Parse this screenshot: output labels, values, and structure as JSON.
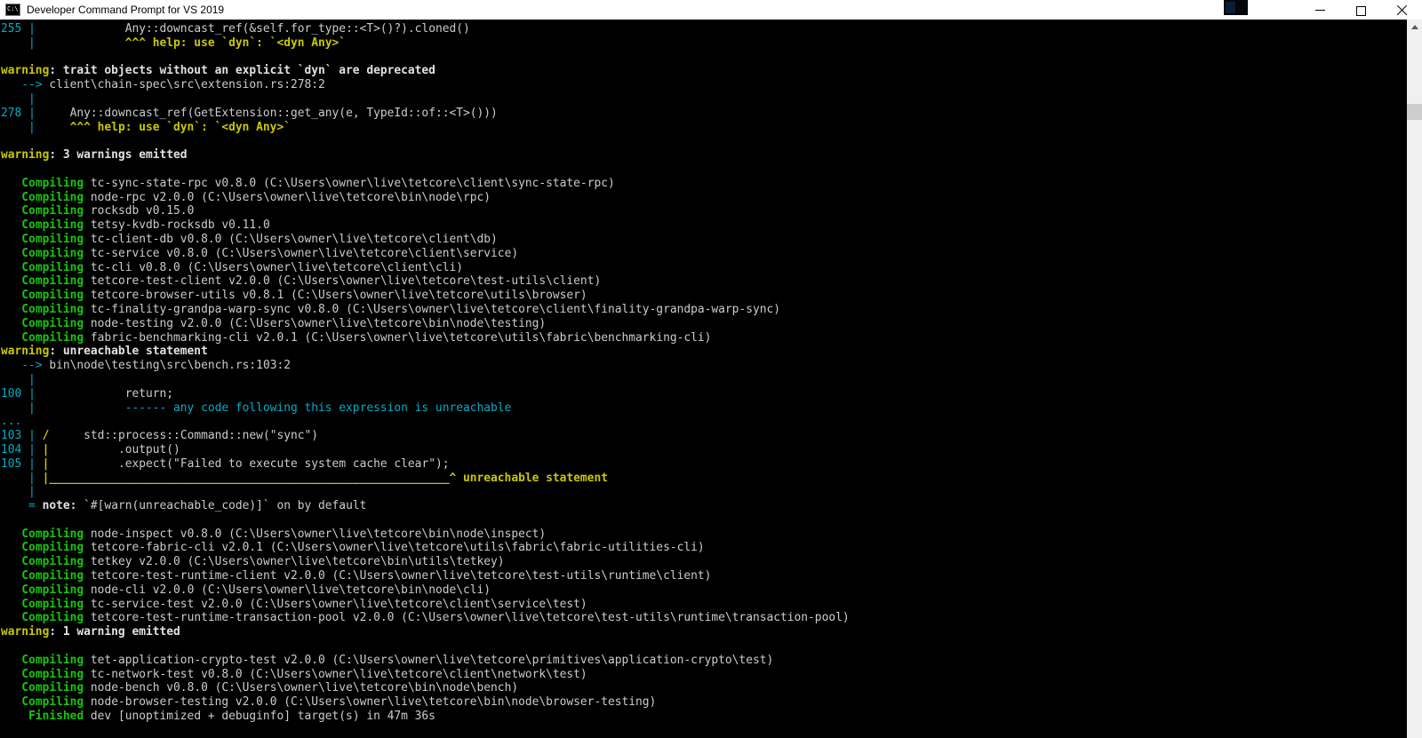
{
  "window": {
    "title": "Developer Command Prompt for VS 2019",
    "controls": {
      "minimize": "minimize",
      "restore": "restore",
      "close": "close"
    }
  },
  "terminal": {
    "colors": {
      "background": "#000000",
      "fg": "#cccccc",
      "wh": "#e2e2e2",
      "gr": "#16c60c",
      "ye": "#c9c800",
      "cy": "#00aec8"
    },
    "lines": [
      [
        [
          "cy",
          "255"
        ],
        [
          "fg",
          " "
        ],
        [
          "cy",
          "|"
        ],
        [
          "fg",
          "             Any::downcast_ref(&self.for_type::<T>()?).cloned()"
        ]
      ],
      [
        [
          "cy",
          "    |"
        ],
        [
          "ye",
          "             ^^^ help: use `dyn`: `<dyn Any>`"
        ]
      ],
      [],
      [
        [
          "ye",
          "warning"
        ],
        [
          "wh",
          ": trait objects without an explicit `dyn` are deprecated"
        ]
      ],
      [
        [
          "fg",
          "   "
        ],
        [
          "cy",
          "-->"
        ],
        [
          "fg",
          " client\\chain-spec\\src\\extension.rs:278:2"
        ]
      ],
      [
        [
          "cy",
          "    |"
        ]
      ],
      [
        [
          "cy",
          "278"
        ],
        [
          "fg",
          " "
        ],
        [
          "cy",
          "|"
        ],
        [
          "fg",
          "     Any::downcast_ref(GetExtension::get_any(e, TypeId::of::<T>()))"
        ]
      ],
      [
        [
          "cy",
          "    |"
        ],
        [
          "ye",
          "     ^^^ help: use `dyn`: `<dyn Any>`"
        ]
      ],
      [],
      [
        [
          "ye",
          "warning"
        ],
        [
          "wh",
          ": 3 warnings emitted"
        ]
      ],
      [],
      [
        [
          "fg",
          "   "
        ],
        [
          "gr",
          "Compiling"
        ],
        [
          "fg",
          " tc-sync-state-rpc v0.8.0 (C:\\Users\\owner\\live\\tetcore\\client\\sync-state-rpc)"
        ]
      ],
      [
        [
          "fg",
          "   "
        ],
        [
          "gr",
          "Compiling"
        ],
        [
          "fg",
          " node-rpc v2.0.0 (C:\\Users\\owner\\live\\tetcore\\bin\\node\\rpc)"
        ]
      ],
      [
        [
          "fg",
          "   "
        ],
        [
          "gr",
          "Compiling"
        ],
        [
          "fg",
          " rocksdb v0.15.0"
        ]
      ],
      [
        [
          "fg",
          "   "
        ],
        [
          "gr",
          "Compiling"
        ],
        [
          "fg",
          " tetsy-kvdb-rocksdb v0.11.0"
        ]
      ],
      [
        [
          "fg",
          "   "
        ],
        [
          "gr",
          "Compiling"
        ],
        [
          "fg",
          " tc-client-db v0.8.0 (C:\\Users\\owner\\live\\tetcore\\client\\db)"
        ]
      ],
      [
        [
          "fg",
          "   "
        ],
        [
          "gr",
          "Compiling"
        ],
        [
          "fg",
          " tc-service v0.8.0 (C:\\Users\\owner\\live\\tetcore\\client\\service)"
        ]
      ],
      [
        [
          "fg",
          "   "
        ],
        [
          "gr",
          "Compiling"
        ],
        [
          "fg",
          " tc-cli v0.8.0 (C:\\Users\\owner\\live\\tetcore\\client\\cli)"
        ]
      ],
      [
        [
          "fg",
          "   "
        ],
        [
          "gr",
          "Compiling"
        ],
        [
          "fg",
          " tetcore-test-client v2.0.0 (C:\\Users\\owner\\live\\tetcore\\test-utils\\client)"
        ]
      ],
      [
        [
          "fg",
          "   "
        ],
        [
          "gr",
          "Compiling"
        ],
        [
          "fg",
          " tetcore-browser-utils v0.8.1 (C:\\Users\\owner\\live\\tetcore\\utils\\browser)"
        ]
      ],
      [
        [
          "fg",
          "   "
        ],
        [
          "gr",
          "Compiling"
        ],
        [
          "fg",
          " tc-finality-grandpa-warp-sync v0.8.0 (C:\\Users\\owner\\live\\tetcore\\client\\finality-grandpa-warp-sync)"
        ]
      ],
      [
        [
          "fg",
          "   "
        ],
        [
          "gr",
          "Compiling"
        ],
        [
          "fg",
          " node-testing v2.0.0 (C:\\Users\\owner\\live\\tetcore\\bin\\node\\testing)"
        ]
      ],
      [
        [
          "fg",
          "   "
        ],
        [
          "gr",
          "Compiling"
        ],
        [
          "fg",
          " fabric-benchmarking-cli v2.0.1 (C:\\Users\\owner\\live\\tetcore\\utils\\fabric\\benchmarking-cli)"
        ]
      ],
      [
        [
          "ye",
          "warning"
        ],
        [
          "wh",
          ": unreachable statement"
        ]
      ],
      [
        [
          "fg",
          "   "
        ],
        [
          "cy",
          "-->"
        ],
        [
          "fg",
          " bin\\node\\testing\\src\\bench.rs:103:2"
        ]
      ],
      [
        [
          "cy",
          "    |"
        ]
      ],
      [
        [
          "cy",
          "100"
        ],
        [
          "fg",
          " "
        ],
        [
          "cy",
          "|"
        ],
        [
          "fg",
          "             return;"
        ]
      ],
      [
        [
          "cy",
          "    |             ------ any code following this expression is unreachable"
        ]
      ],
      [
        [
          "cy",
          "..."
        ]
      ],
      [
        [
          "cy",
          "103"
        ],
        [
          "fg",
          " "
        ],
        [
          "cy",
          "|"
        ],
        [
          "fg",
          " "
        ],
        [
          "ye",
          "/"
        ],
        [
          "fg",
          "     std::process::Command::new(\"sync\")"
        ]
      ],
      [
        [
          "cy",
          "104"
        ],
        [
          "fg",
          " "
        ],
        [
          "cy",
          "|"
        ],
        [
          "fg",
          " "
        ],
        [
          "ye",
          "|"
        ],
        [
          "fg",
          "          .output()"
        ]
      ],
      [
        [
          "cy",
          "105"
        ],
        [
          "fg",
          " "
        ],
        [
          "cy",
          "|"
        ],
        [
          "fg",
          " "
        ],
        [
          "ye",
          "|"
        ],
        [
          "fg",
          "          .expect(\"Failed to execute system cache clear\");"
        ]
      ],
      [
        [
          "cy",
          "    |"
        ],
        [
          "fg",
          " "
        ],
        [
          "ye",
          "|__________________________________________________________^ unreachable statement"
        ]
      ],
      [
        [
          "cy",
          "    |"
        ]
      ],
      [
        [
          "cy",
          "    ="
        ],
        [
          "fg",
          " "
        ],
        [
          "wh",
          "note:"
        ],
        [
          "fg",
          " `#[warn(unreachable_code)]` on by default"
        ]
      ],
      [],
      [
        [
          "fg",
          "   "
        ],
        [
          "gr",
          "Compiling"
        ],
        [
          "fg",
          " node-inspect v0.8.0 (C:\\Users\\owner\\live\\tetcore\\bin\\node\\inspect)"
        ]
      ],
      [
        [
          "fg",
          "   "
        ],
        [
          "gr",
          "Compiling"
        ],
        [
          "fg",
          " tetcore-fabric-cli v2.0.1 (C:\\Users\\owner\\live\\tetcore\\utils\\fabric\\fabric-utilities-cli)"
        ]
      ],
      [
        [
          "fg",
          "   "
        ],
        [
          "gr",
          "Compiling"
        ],
        [
          "fg",
          " tetkey v2.0.0 (C:\\Users\\owner\\live\\tetcore\\bin\\utils\\tetkey)"
        ]
      ],
      [
        [
          "fg",
          "   "
        ],
        [
          "gr",
          "Compiling"
        ],
        [
          "fg",
          " tetcore-test-runtime-client v2.0.0 (C:\\Users\\owner\\live\\tetcore\\test-utils\\runtime\\client)"
        ]
      ],
      [
        [
          "fg",
          "   "
        ],
        [
          "gr",
          "Compiling"
        ],
        [
          "fg",
          " node-cli v2.0.0 (C:\\Users\\owner\\live\\tetcore\\bin\\node\\cli)"
        ]
      ],
      [
        [
          "fg",
          "   "
        ],
        [
          "gr",
          "Compiling"
        ],
        [
          "fg",
          " tc-service-test v2.0.0 (C:\\Users\\owner\\live\\tetcore\\client\\service\\test)"
        ]
      ],
      [
        [
          "fg",
          "   "
        ],
        [
          "gr",
          "Compiling"
        ],
        [
          "fg",
          " tetcore-test-runtime-transaction-pool v2.0.0 (C:\\Users\\owner\\live\\tetcore\\test-utils\\runtime\\transaction-pool)"
        ]
      ],
      [
        [
          "ye",
          "warning"
        ],
        [
          "wh",
          ": 1 warning emitted"
        ]
      ],
      [],
      [
        [
          "fg",
          "   "
        ],
        [
          "gr",
          "Compiling"
        ],
        [
          "fg",
          " tet-application-crypto-test v2.0.0 (C:\\Users\\owner\\live\\tetcore\\primitives\\application-crypto\\test)"
        ]
      ],
      [
        [
          "fg",
          "   "
        ],
        [
          "gr",
          "Compiling"
        ],
        [
          "fg",
          " tc-network-test v0.8.0 (C:\\Users\\owner\\live\\tetcore\\client\\network\\test)"
        ]
      ],
      [
        [
          "fg",
          "   "
        ],
        [
          "gr",
          "Compiling"
        ],
        [
          "fg",
          " node-bench v0.8.0 (C:\\Users\\owner\\live\\tetcore\\bin\\node\\bench)"
        ]
      ],
      [
        [
          "fg",
          "   "
        ],
        [
          "gr",
          "Compiling"
        ],
        [
          "fg",
          " node-browser-testing v2.0.0 (C:\\Users\\owner\\live\\tetcore\\bin\\node\\browser-testing)"
        ]
      ],
      [
        [
          "fg",
          "    "
        ],
        [
          "gr",
          "Finished"
        ],
        [
          "fg",
          " dev [unoptimized + debuginfo] target(s) in 47m 36s"
        ]
      ]
    ]
  }
}
